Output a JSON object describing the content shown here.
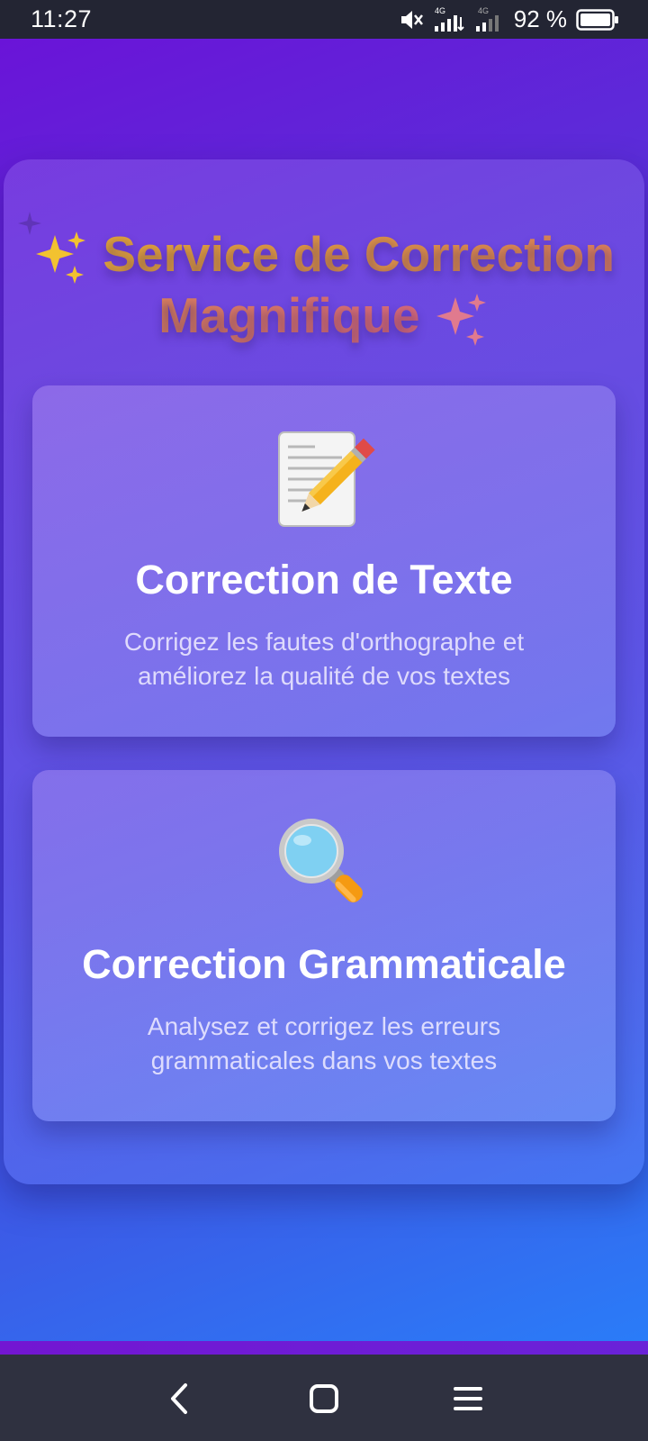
{
  "status_bar": {
    "time": "11:27",
    "network_1": "4G",
    "network_2": "4G",
    "battery": "92 %"
  },
  "title": {
    "text": "Service de Correction Magnifique",
    "leading_icon": "sparkles-icon",
    "trailing_icon": "sparkles-icon"
  },
  "cards": [
    {
      "icon": "memo-pencil-icon",
      "title": "Correction de Texte",
      "description": "Corrigez les fautes d'orthographe et améliorez la qualité de vos textes"
    },
    {
      "icon": "magnifying-glass-icon",
      "title": "Correction Grammaticale",
      "description": "Analysez et corrigez les erreurs grammaticales dans vos textes"
    }
  ],
  "nav_bar": {
    "back": "back-icon",
    "home": "home-icon",
    "menu": "menu-icon"
  },
  "colors": {
    "gradient_start": "#6a14d8",
    "gradient_end": "#2a7cf8",
    "title_gold": "#e2a43a",
    "title_pink": "#d76a7c"
  }
}
